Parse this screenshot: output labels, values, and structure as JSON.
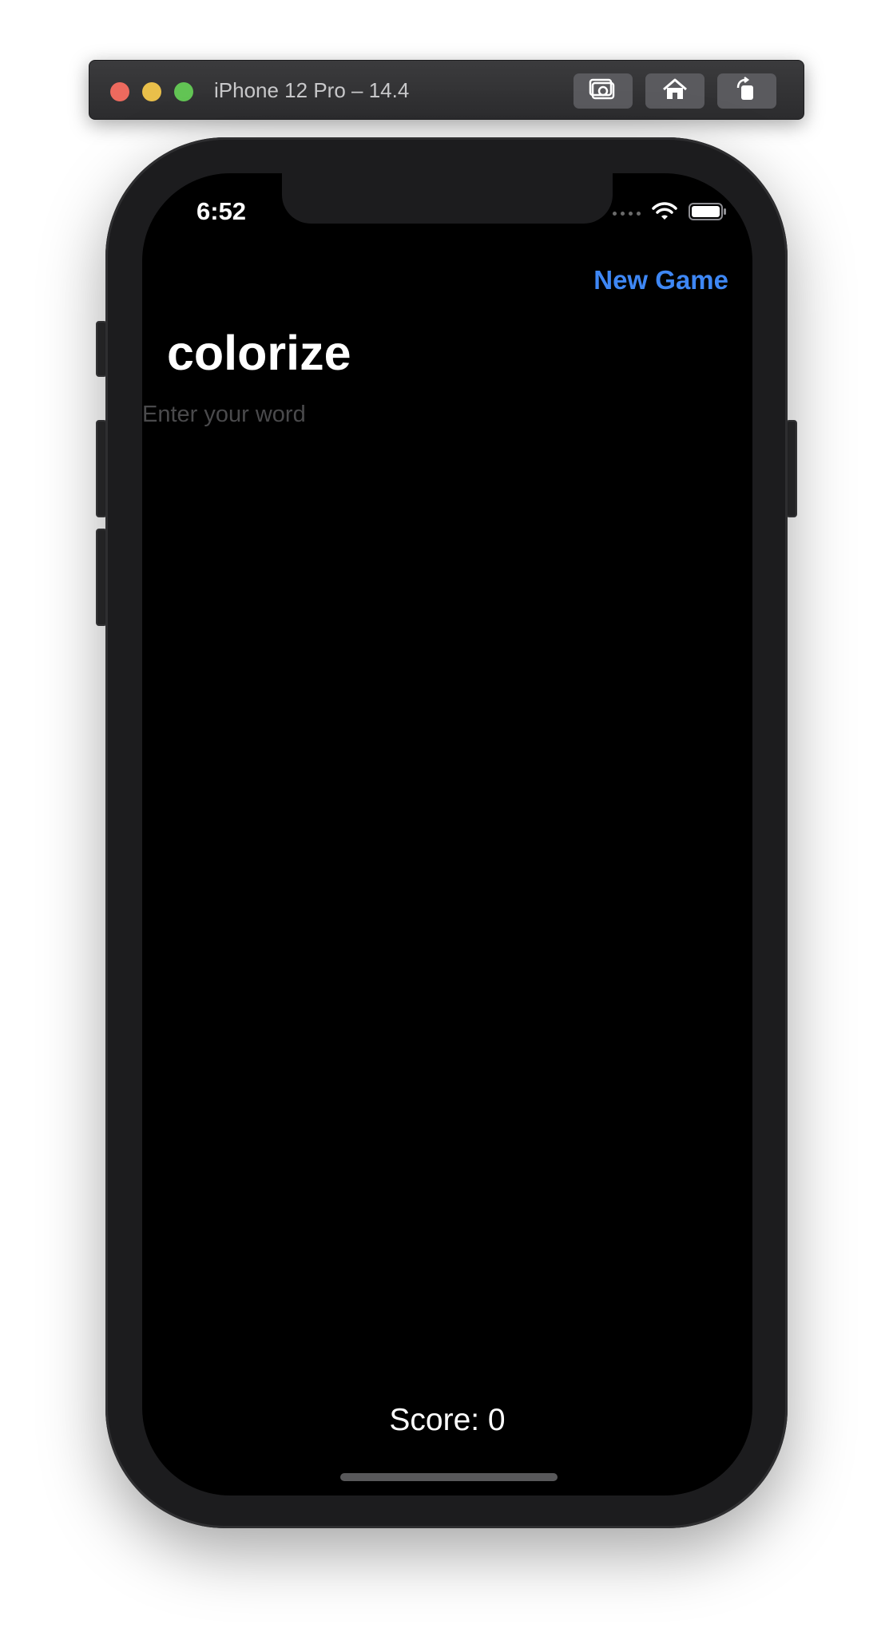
{
  "simulator": {
    "title": "iPhone 12 Pro – 14.4",
    "buttons": [
      "screenshot-icon",
      "home-icon",
      "rotate-icon"
    ]
  },
  "status_bar": {
    "time": "6:52"
  },
  "nav": {
    "new_game_label": "New Game"
  },
  "game": {
    "root_word": "colorize",
    "input_placeholder": "Enter your word",
    "input_value": "",
    "score_text": "Score: 0"
  },
  "colors": {
    "accent": "#3e87f5",
    "background": "#000000",
    "text": "#ffffff"
  }
}
